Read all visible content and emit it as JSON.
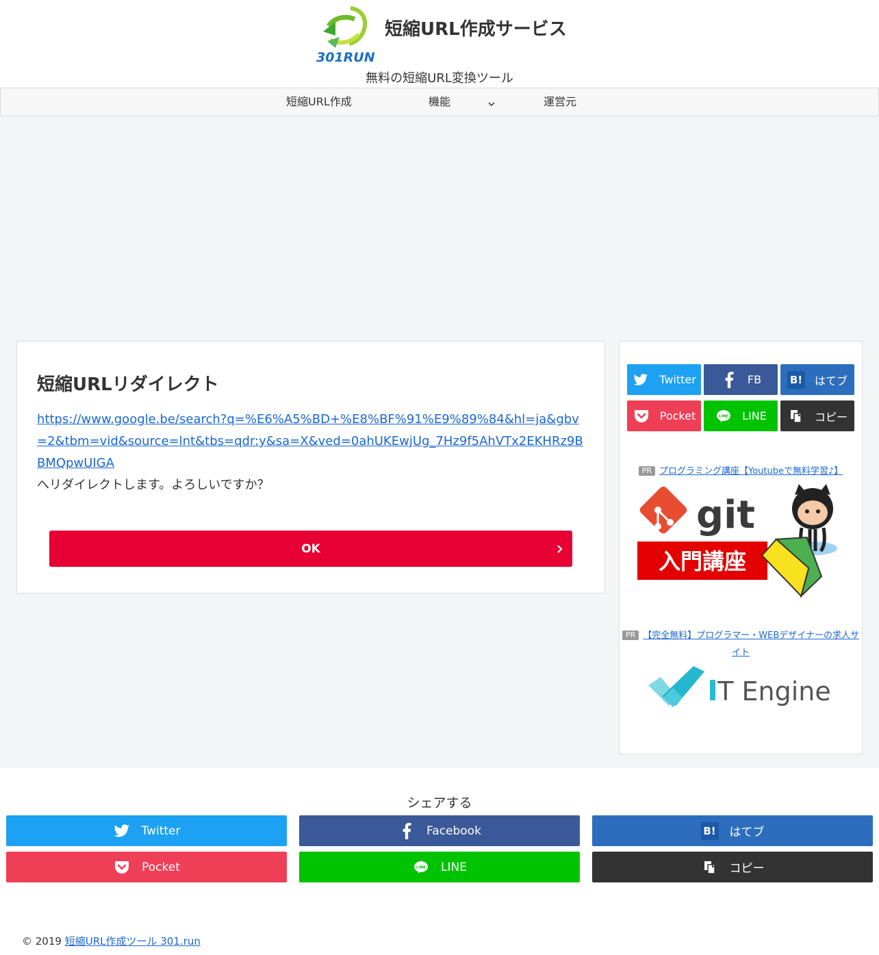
{
  "header": {
    "logo_text": "301RUN",
    "site_title": "短縮URL作成サービス",
    "tagline": "無料の短縮URL変換ツール"
  },
  "nav": {
    "items": [
      {
        "label": "短縮URL作成"
      },
      {
        "label": "機能"
      },
      {
        "label": "運営元"
      }
    ]
  },
  "main": {
    "title": "短縮URLリダイレクト",
    "redirect_url": "https://www.google.be/search?q=%E6%A5%BD+%E8%BF%91%E9%89%84&hl=ja&gbv=2&tbm=vid&source=lnt&tbs=qdr:y&sa=X&ved=0ahUKEwjUg_7Hz9f5AhVTx2EKHRz9BBMQpwUIGA",
    "confirm_text": "へリダイレクトします。よろしいですか？",
    "ok_label": "OK"
  },
  "sidebar": {
    "share_buttons": [
      {
        "label": "Twitter"
      },
      {
        "label": "FB"
      },
      {
        "label": "はてブ"
      },
      {
        "label": "Pocket"
      },
      {
        "label": "LINE"
      },
      {
        "label": "コピー"
      }
    ],
    "ads": [
      {
        "badge": "PR",
        "text": "プログラミング講座【Youtubeで無料学習♪】",
        "banner_word": "git",
        "banner_caption": "入門講座"
      },
      {
        "badge": "PR",
        "text": "【完全無料】プログラマー・WEBデザイナーの求人サイト",
        "banner_word": "IT Engine"
      }
    ]
  },
  "footer": {
    "share_heading": "シェアする",
    "share_buttons": [
      {
        "label": "Twitter"
      },
      {
        "label": "Facebook"
      },
      {
        "label": "はてブ"
      },
      {
        "label": "Pocket"
      },
      {
        "label": "LINE"
      },
      {
        "label": "コピー"
      }
    ],
    "copyright_prefix": "© 2019",
    "copyright_link": "短縮URL作成ツール 301.run"
  },
  "colors": {
    "twitter": "#1da1f2",
    "facebook": "#3b5998",
    "hatena": "#2c6ebd",
    "pocket": "#ef3f56",
    "line": "#00c300",
    "copy": "#333333",
    "ok_button": "#e60033",
    "link": "#1967d2",
    "page_bg": "#f4f5f7"
  }
}
